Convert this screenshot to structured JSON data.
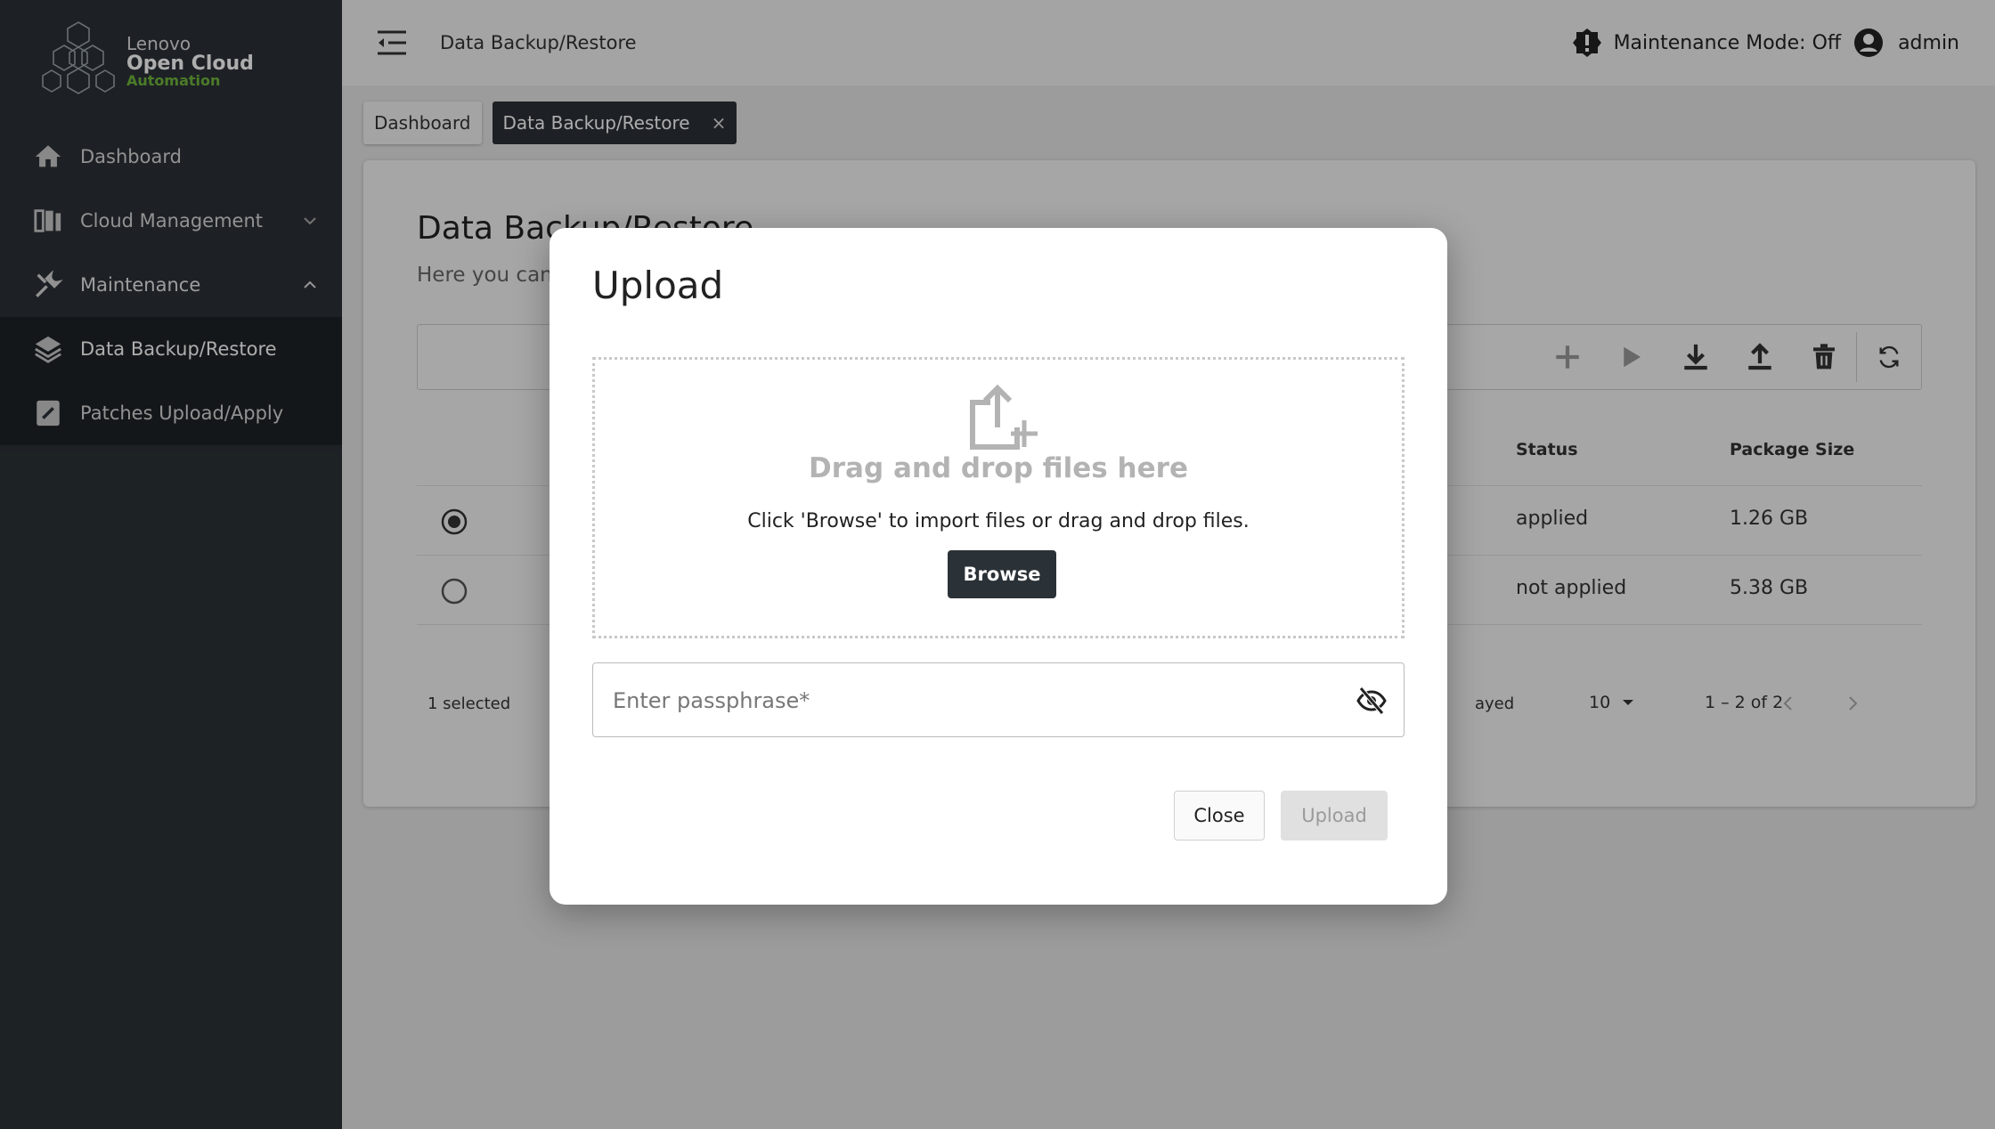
{
  "brand": {
    "line1": "Lenovo",
    "line2": "Open Cloud",
    "line3": "Automation",
    "accent": "#6fb63b"
  },
  "sidebar": {
    "items": [
      {
        "label": "Dashboard",
        "icon": "home-icon"
      },
      {
        "label": "Cloud Management",
        "icon": "server-rack-icon",
        "expand": "chevron-down-icon"
      },
      {
        "label": "Maintenance",
        "icon": "wrench-icon",
        "expand": "chevron-up-icon"
      },
      {
        "label": "Data Backup/Restore",
        "icon": "layers-icon",
        "active": true
      },
      {
        "label": "Patches Upload/Apply",
        "icon": "patch-icon"
      }
    ]
  },
  "topbar": {
    "breadcrumb": "Data Backup/Restore",
    "maintenance": "Maintenance Mode: Off",
    "user": "admin"
  },
  "tabs": [
    {
      "label": "Dashboard"
    },
    {
      "label": "Data Backup/Restore",
      "close": "×"
    }
  ],
  "page": {
    "title": "Data Backup/Restore",
    "subtitle": "Here you can f"
  },
  "table": {
    "headers": {
      "status": "Status",
      "size": "Package Size"
    },
    "rows": [
      {
        "status": "applied",
        "size": "1.26 GB",
        "selected": true
      },
      {
        "status": "not applied",
        "size": "5.38 GB",
        "selected": false
      }
    ],
    "footer": {
      "selected": "1 selected",
      "items_label": "ayed",
      "per_page": "10",
      "range": "1 – 2 of 2"
    }
  },
  "modal": {
    "title": "Upload",
    "drop_title": "Drag and drop files here",
    "drop_hint": "Click 'Browse' to import files or drag and drop files.",
    "browse": "Browse",
    "passphrase_placeholder": "Enter passphrase*",
    "close": "Close",
    "upload": "Upload"
  },
  "colors": {
    "sidebar": "#2b3237",
    "sidebar_sub": "#1e2326",
    "primary": "#2b3237"
  }
}
